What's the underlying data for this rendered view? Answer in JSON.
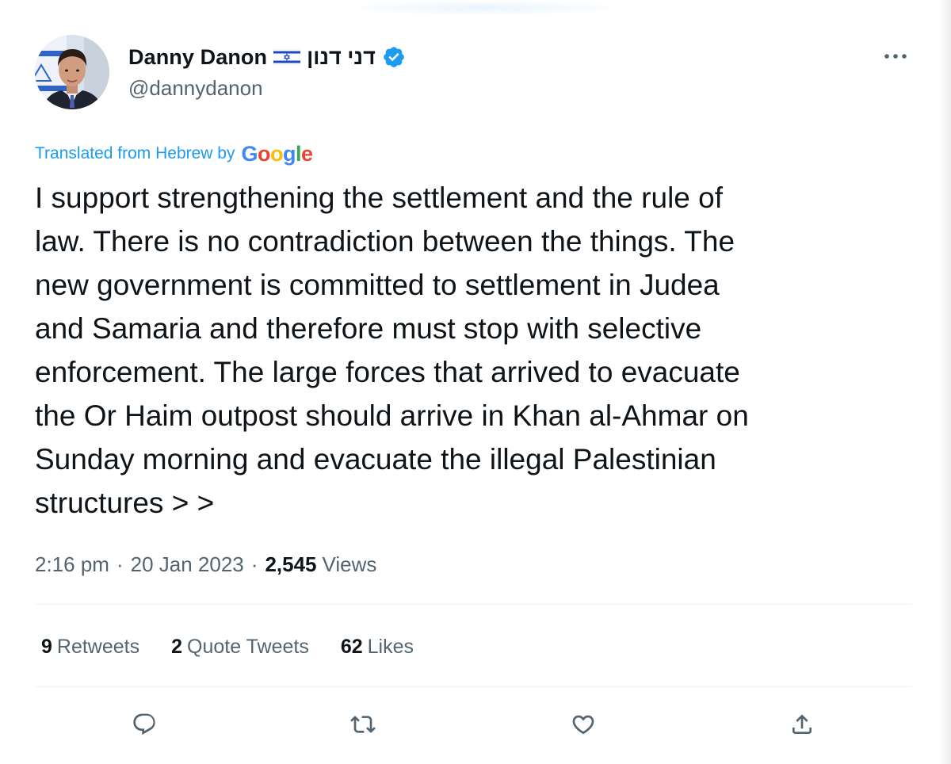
{
  "author": {
    "display_name": "Danny Danon",
    "hebrew_name": "דני דנון",
    "handle": "@dannydanon",
    "flag_icon": "israel-flag-icon",
    "verified_icon": "verified-badge-icon"
  },
  "translation": {
    "label": "Translated from Hebrew by",
    "provider": [
      "G",
      "o",
      "o",
      "g",
      "l",
      "e"
    ]
  },
  "tweet": {
    "text": "I support strengthening the settlement and the rule of\nlaw. There is no contradiction between the things. The\nnew government is committed to settlement in Judea\nand Samaria and therefore must stop with selective\nenforcement. The large forces that arrived to evacuate\nthe Or Haim outpost should arrive in Khan al-Ahmar on\nSunday morning and evacuate the illegal Palestinian\nstructures > >"
  },
  "meta": {
    "time": "2:16 pm",
    "separator": "·",
    "date": "20 Jan 2023",
    "views_count": "2,545",
    "views_label": "Views"
  },
  "stats": {
    "retweets": {
      "count": "9",
      "label": "Retweets"
    },
    "quotes": {
      "count": "2",
      "label": "Quote Tweets"
    },
    "likes": {
      "count": "62",
      "label": "Likes"
    }
  },
  "actions": {
    "reply": "reply-icon",
    "retweet": "retweet-icon",
    "like": "heart-icon",
    "share": "share-icon"
  },
  "colors": {
    "accent": "#1d9bf0",
    "text_primary": "#0f1419",
    "text_secondary": "#536471",
    "divider": "#eff3f4",
    "google_blue": "#4285f4",
    "google_red": "#ea4335",
    "google_yellow": "#fbbc05",
    "google_green": "#34a853"
  }
}
